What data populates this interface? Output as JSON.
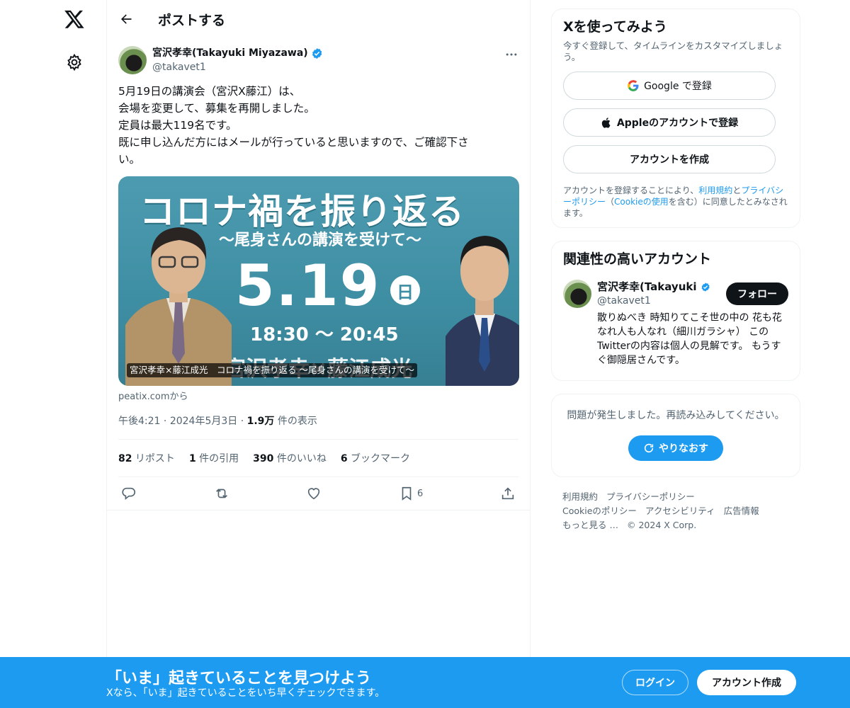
{
  "nav": {
    "logo_icon": "x-logo-icon",
    "settings_icon": "gear-icon"
  },
  "header": {
    "title": "ポストする",
    "back_icon": "arrow-left-icon"
  },
  "post": {
    "author": {
      "name": "宮沢孝幸(Takayuki Miyazawa)",
      "handle": "@takavet1",
      "verified": true
    },
    "text_lines": [
      "5月19日の講演会（宮沢X藤江）は、",
      "会場を変更して、募集を再開しました。",
      "定員は最大119名です。",
      "既に申し込んだ方にはメールが行っていると思いますので、ご確認下さ",
      "い。"
    ],
    "media": {
      "headline": "コロナ禍を振り返る",
      "subheadline": "〜尾身さんの講演を受けて〜",
      "date": "5.19",
      "day": "日",
      "time": "18:30 〜 20:45",
      "names": "宮沢孝幸×藤江成光",
      "caption": "宮沢孝幸×藤江成光　コロナ禍を振り返る 〜尾身さんの講演を受けて〜"
    },
    "source": "peatix.comから",
    "time": "午後4:21",
    "date": "2024年5月3日",
    "views_count": "1.9万",
    "views_label": " 件の表示",
    "stats": {
      "reposts_count": "82",
      "reposts_label": " リポスト",
      "quotes_count": "1",
      "quotes_label": " 件の引用",
      "likes_count": "390",
      "likes_label": " 件のいいね",
      "bookmarks_count": "6",
      "bookmarks_label": " ブックマーク"
    },
    "actions": {
      "bookmark_count": "6"
    }
  },
  "signup": {
    "title": "Xを使ってみよう",
    "subtitle": "今すぐ登録して、タイムラインをカスタマイズしましょう。",
    "google_label": "Google で登録",
    "apple_label": "Appleのアカウントで登録",
    "create_label": "アカウントを作成",
    "terms_prefix": "アカウントを登録することにより、",
    "terms_link": "利用規約",
    "terms_and": "と",
    "privacy_link": "プライバシーポリシー",
    "terms_paren_open": "（",
    "cookie_link": "Cookieの使用",
    "terms_suffix": "を含む）に同意したとみなされます。"
  },
  "relevant": {
    "title": "関連性の高いアカウント",
    "name": "宮沢孝幸(Takayuki Miyazawa)",
    "handle": "@takavet1",
    "follow_label": "フォロー",
    "bio": "散りぬべき 時知りてこそ世の中の 花も花なれ人も人なれ（細川ガラシャ） このTwitterの内容は個人の見解です。 もうすぐ御隠居さんです。"
  },
  "error": {
    "message": "問題が発生しました。再読み込みしてください。",
    "retry_label": "やりなおす"
  },
  "footer": {
    "links": [
      "利用規約",
      "プライバシーポリシー",
      "Cookieのポリシー",
      "アクセシビリティ",
      "広告情報",
      "もっと見る …",
      "© 2024 X Corp."
    ]
  },
  "banner": {
    "title": "「いま」起きていることを見つけよう",
    "subtitle": "Xなら、「いま」起きていることをいち早くチェックできます。",
    "login_label": "ログイン",
    "signup_label": "アカウント作成"
  },
  "colors": {
    "accent": "#1d9bf0",
    "text": "#0f1419",
    "muted": "#536471",
    "border": "#eff3f4"
  }
}
